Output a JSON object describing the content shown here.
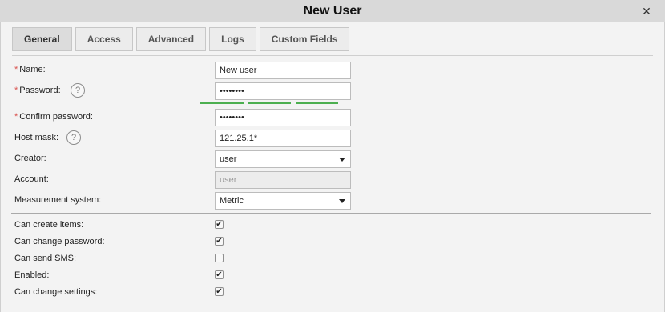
{
  "window": {
    "title": "New User",
    "close_icon": "close-icon"
  },
  "tabs": [
    {
      "label": "General",
      "active": true
    },
    {
      "label": "Access",
      "active": false
    },
    {
      "label": "Advanced",
      "active": false
    },
    {
      "label": "Logs",
      "active": false
    },
    {
      "label": "Custom Fields",
      "active": false
    }
  ],
  "form": {
    "required_mark": "*",
    "name": {
      "label": "Name:",
      "value": "New user"
    },
    "password": {
      "label": "Password:",
      "value": "••••••••",
      "strength_segments": 3
    },
    "confirm_password": {
      "label": "Confirm password:",
      "value": "••••••••"
    },
    "host_mask": {
      "label": "Host mask:",
      "value": "121.25.1*"
    },
    "creator": {
      "label": "Creator:",
      "value": "user"
    },
    "account": {
      "label": "Account:",
      "placeholder": "user"
    },
    "measurement": {
      "label": "Measurement system:",
      "value": "Metric"
    },
    "help_glyph": "?"
  },
  "checkboxes": [
    {
      "label": "Can create items:",
      "checked": true
    },
    {
      "label": "Can change password:",
      "checked": true
    },
    {
      "label": "Can send SMS:",
      "checked": false
    },
    {
      "label": "Enabled:",
      "checked": true
    },
    {
      "label": "Can change settings:",
      "checked": true
    }
  ],
  "colors": {
    "strength": "#4caf50",
    "required": "#d9534f"
  }
}
